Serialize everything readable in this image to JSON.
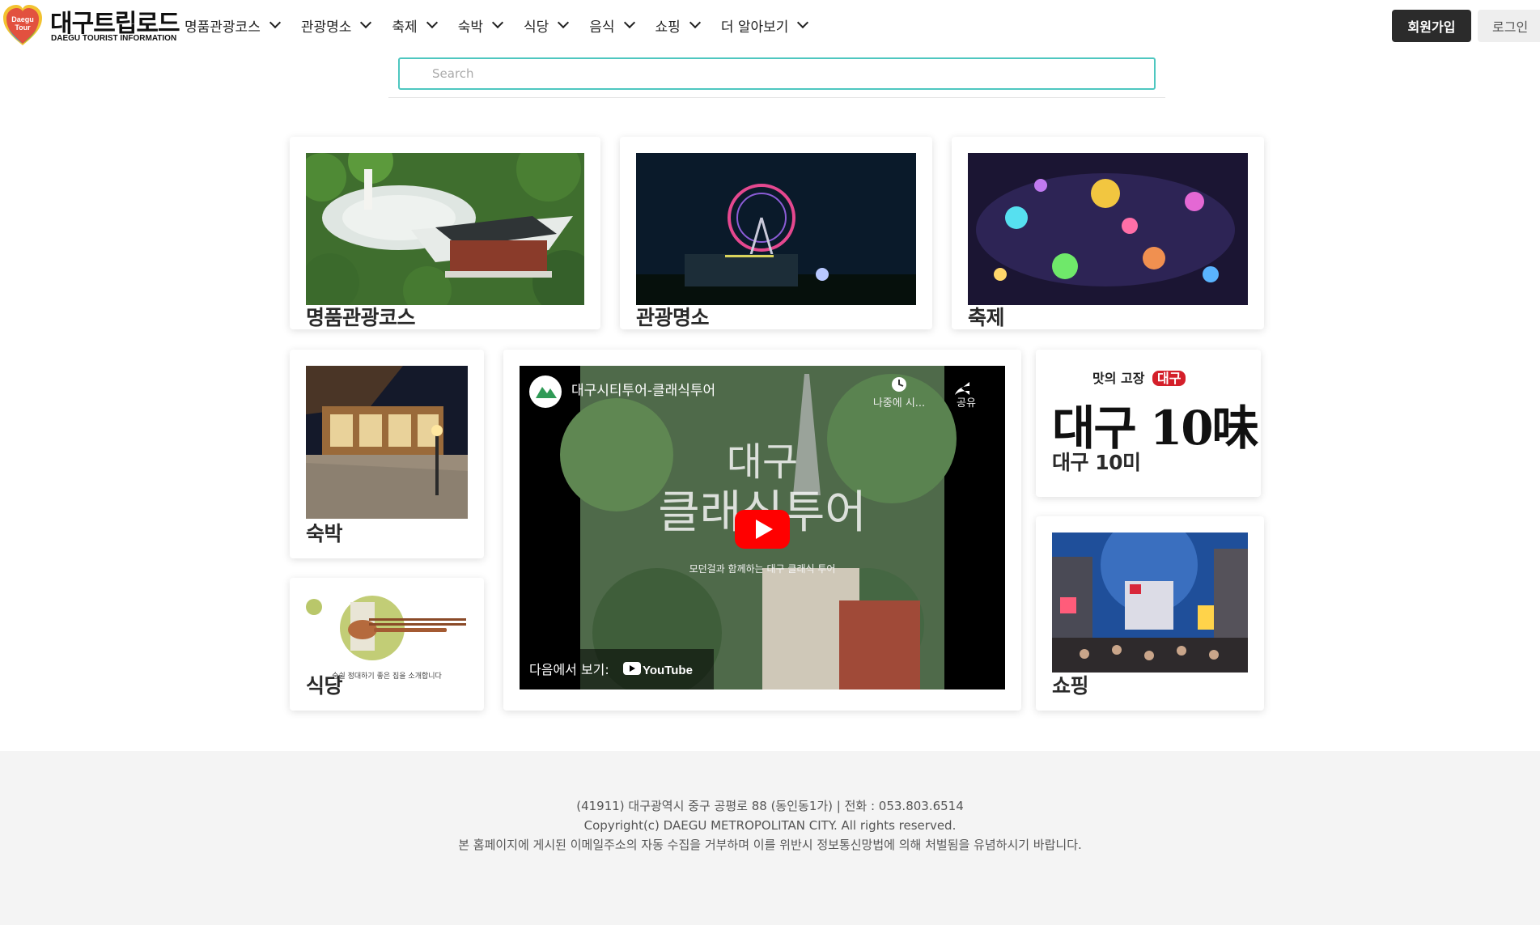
{
  "brand": {
    "title": "대구트립로드",
    "subtitle": "DAEGU TOURIST INFORMATION",
    "badge_line1": "Daegu",
    "badge_line2": "Tour"
  },
  "nav": {
    "items": [
      {
        "label": "명품관광코스"
      },
      {
        "label": "관광명소"
      },
      {
        "label": "축제"
      },
      {
        "label": "숙박"
      },
      {
        "label": "식당"
      },
      {
        "label": "음식"
      },
      {
        "label": "쇼핑"
      },
      {
        "label": "더 알아보기"
      }
    ],
    "join_label": "회원가입",
    "login_label": "로그인"
  },
  "search": {
    "placeholder": "Search"
  },
  "cards": {
    "course": {
      "label": "명품관광코스"
    },
    "attractions": {
      "label": "관광명소"
    },
    "festival": {
      "label": "축제"
    },
    "lodging": {
      "label": "숙박"
    },
    "restaurant": {
      "label": "식당",
      "image_caption": "숨쉴 정대하기 좋은 집을 소개합니다"
    },
    "tastes": {
      "label": "대구 10미",
      "tagline_prefix": "맛의 고장",
      "tagline_badge": "대구",
      "calligraphy": "대구 10味"
    },
    "shopping": {
      "label": "쇼핑"
    }
  },
  "video": {
    "title": "대구시티투어-클래식투어",
    "watch_later": "나중에 시...",
    "share": "공유",
    "overlay_line1": "대구",
    "overlay_line2": "클래식투어",
    "overlay_sub": "모던걸과 함께하는 대구 클래식 투어",
    "watch_on": "다음에서 보기:",
    "youtube": "YouTube"
  },
  "footer": {
    "line1": "(41911) 대구광역시 중구 공평로 88 (동인동1가) | 전화 : 053.803.6514",
    "line2": "Copyright(c) DAEGU METROPOLITAN CITY. All rights reserved.",
    "line3": "본 홈페이지에 게시된 이메일주소의 자동 수집을 거부하며 이를 위반시 정보통신망법에 의해 처벌됨을 유념하시기 바랍니다."
  },
  "colors": {
    "accent": "#4ec7c0",
    "join_button": "#2b2b2b",
    "login_button": "#eeeeee",
    "footer_bg": "#f4f4f4",
    "youtube_red": "#ff0000"
  }
}
